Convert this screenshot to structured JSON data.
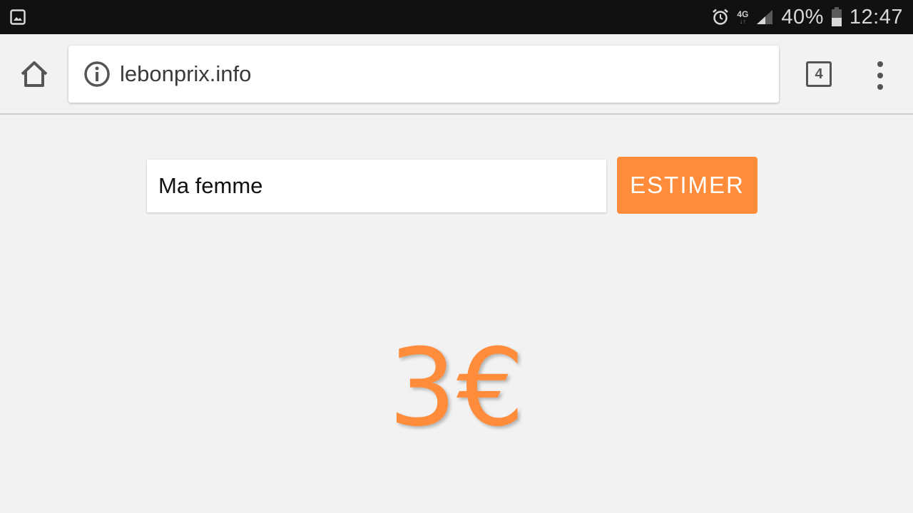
{
  "status_bar": {
    "battery_percent": "40%",
    "time": "12:47",
    "network": "4G",
    "icons": [
      "gallery-icon",
      "alarm-icon",
      "network-4g-icon",
      "signal-icon",
      "battery-icon"
    ]
  },
  "browser": {
    "url": "lebonprix.info",
    "tab_count": "4",
    "icons": [
      "home-icon",
      "info-icon",
      "tabs-icon",
      "overflow-menu-icon"
    ]
  },
  "page": {
    "input_value": "Ma femme",
    "button_label": "ESTIMER",
    "result_price": "3€"
  },
  "colors": {
    "accent": "#ff8c3a",
    "status_bar": "#111111",
    "background": "#f2f2f2"
  }
}
